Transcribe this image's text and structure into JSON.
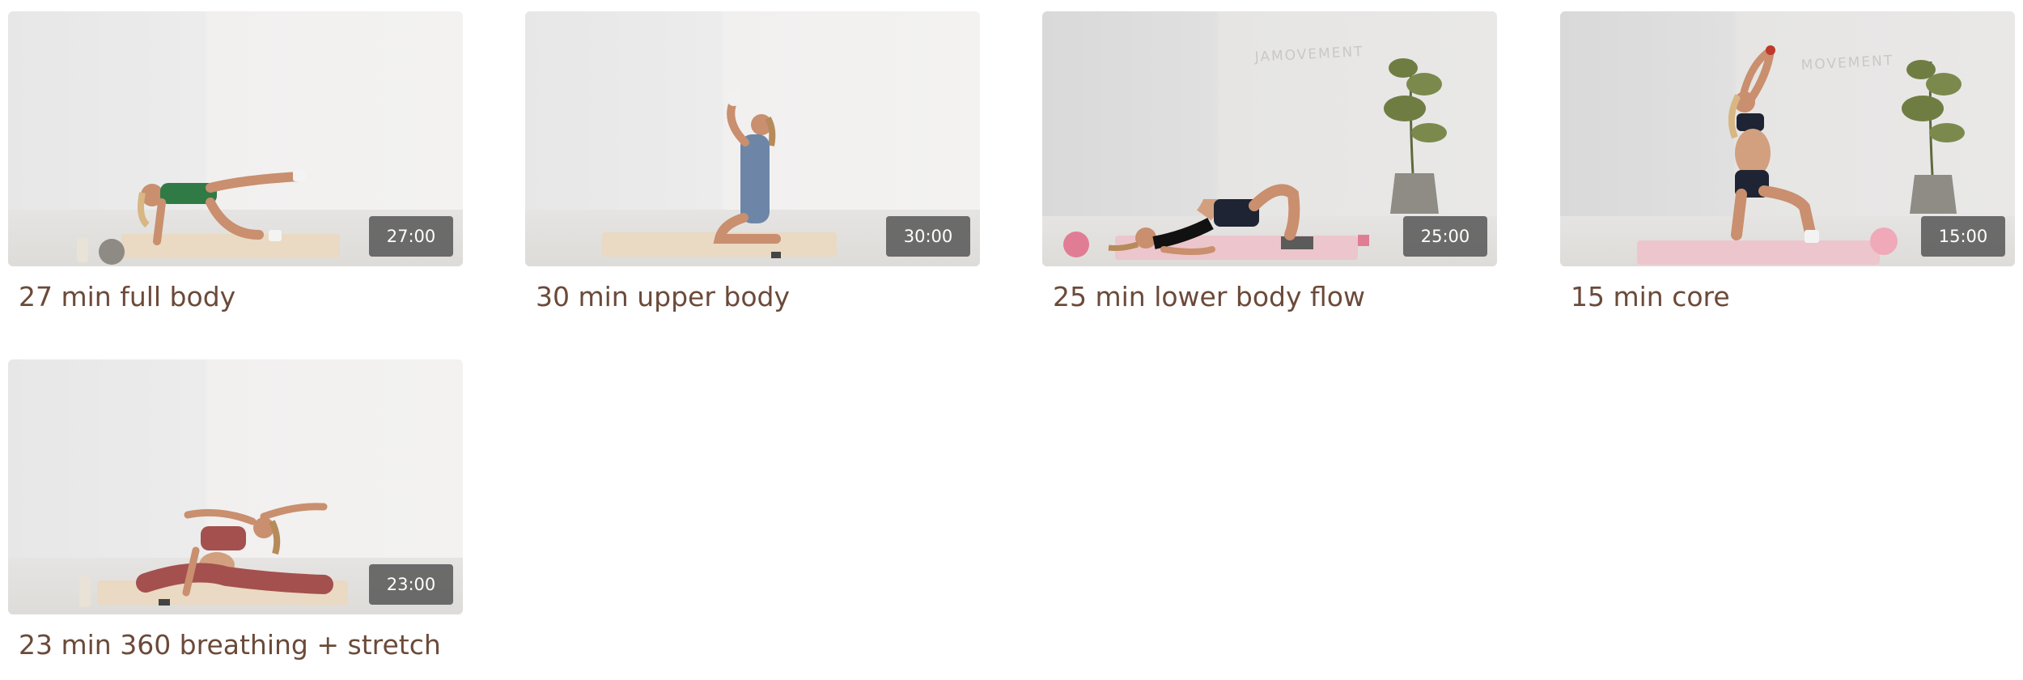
{
  "colors": {
    "title_text": "#6b4a39",
    "duration_badge_bg": "#5a5a5a",
    "duration_badge_text": "#ffffff"
  },
  "videos": [
    {
      "title": "27 min full body",
      "duration": "27:00",
      "thumbnail": "woman-bird-dog-exercise-green-outfit"
    },
    {
      "title": "30 min upper body",
      "duration": "30:00",
      "thumbnail": "woman-kneeling-blue-outfit"
    },
    {
      "title": "25 min lower body flow",
      "duration": "25:00",
      "thumbnail": "woman-glute-bridge-black-outfit",
      "wall_text": "JAMOVEMENT"
    },
    {
      "title": "15 min core",
      "duration": "15:00",
      "thumbnail": "woman-lunge-arms-raised-black-outfit",
      "wall_text": "MOVEMENT"
    },
    {
      "title": "23 min 360 breathing + stretch",
      "duration": "23:00",
      "thumbnail": "woman-side-stretch-red-outfit"
    }
  ]
}
